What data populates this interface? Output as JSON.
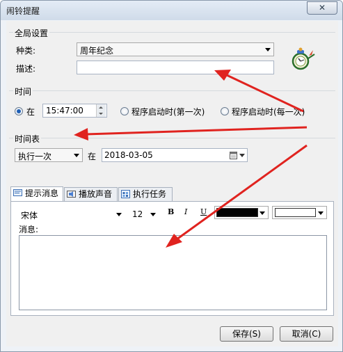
{
  "window": {
    "title": "闹铃提醒",
    "close_glyph": "✕"
  },
  "global": {
    "group_title": "全局设置",
    "type_label": "种类:",
    "type_value": "周年纪念",
    "desc_label": "描述:",
    "desc_value": "",
    "icon": "alarm-clock-icon"
  },
  "time": {
    "group_title": "时间",
    "at_label": "在",
    "time_value": "15:47:00",
    "opt_first": "程序启动时(第一次)",
    "opt_every": "程序启动时(每一次)",
    "selected": "at"
  },
  "schedule": {
    "group_title": "时间表",
    "repeat_value": "执行一次",
    "at_label": "在",
    "date_value": "2018-03-05"
  },
  "tabs": [
    {
      "label": "提示消息",
      "icon": "message-icon",
      "active": true
    },
    {
      "label": "播放声音",
      "icon": "sound-icon",
      "active": false
    },
    {
      "label": "执行任务",
      "icon": "task-icon",
      "active": false
    }
  ],
  "format": {
    "font_value": "宋体",
    "size_value": "12",
    "bold": "B",
    "italic": "I",
    "underline": "U",
    "text_color": "#000000",
    "bg_color": "#ffffff"
  },
  "message": {
    "label": "消息:",
    "value": ""
  },
  "buttons": {
    "save": "保存(S)",
    "cancel": "取消(C)"
  },
  "annotation_color": "#e0231f"
}
